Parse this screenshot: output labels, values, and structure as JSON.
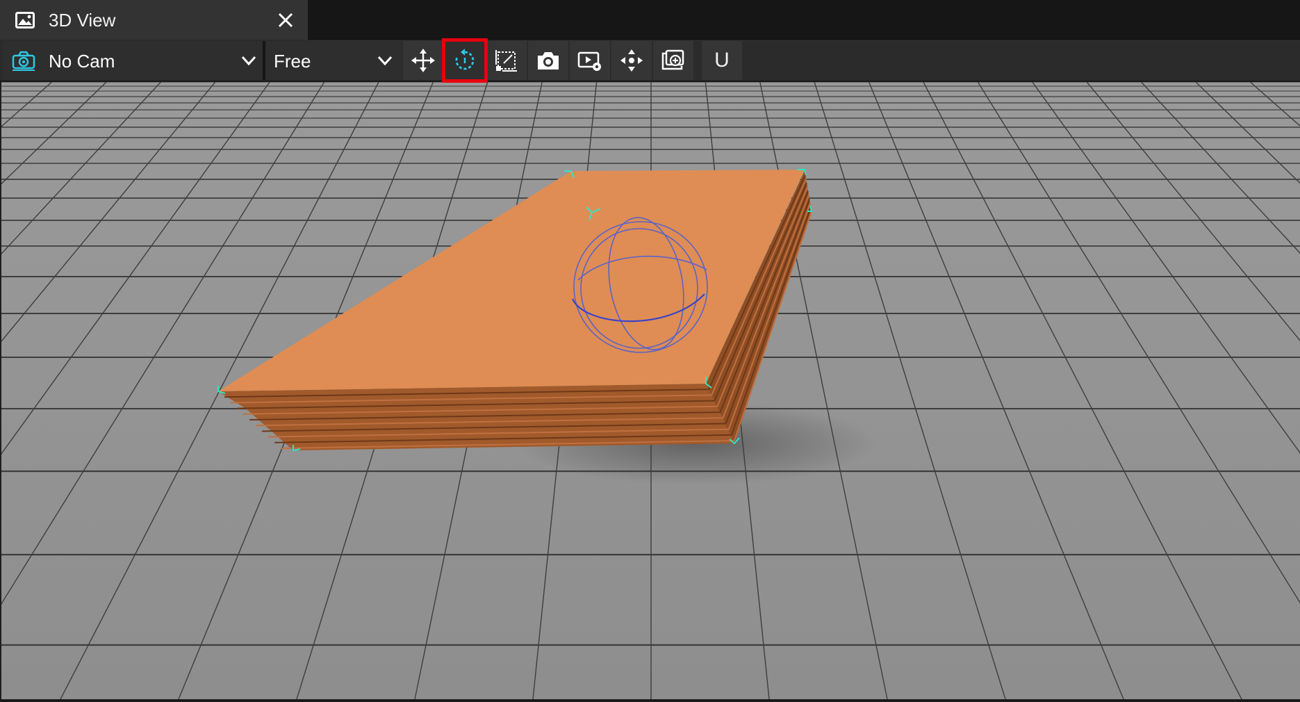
{
  "tab": {
    "title": "3D View",
    "icon": "image-icon",
    "close_icon": "close-icon"
  },
  "toolbar": {
    "camera_dropdown": {
      "value": "No Cam",
      "icon": "camera-view-icon"
    },
    "mode_dropdown": {
      "value": "Free"
    },
    "tools": [
      {
        "name": "move-icon",
        "label": ""
      },
      {
        "name": "rotate-icon",
        "label": "",
        "selected": true
      },
      {
        "name": "scale-icon",
        "label": ""
      },
      {
        "name": "camera-icon",
        "label": ""
      },
      {
        "name": "render-settings-icon",
        "label": ""
      },
      {
        "name": "center-view-icon",
        "label": ""
      },
      {
        "name": "add-camera-icon",
        "label": ""
      },
      {
        "name": "u-button",
        "label": "U"
      }
    ],
    "u_label": "U"
  },
  "viewport": {
    "description_colors": {
      "ground": "#8a8a8a",
      "grid_line": "#3a3a3a",
      "object_top": "#df8d54",
      "object_side": "#a0582a",
      "selection_marker": "#2ee6c8",
      "gizmo": "#5b63c8"
    }
  },
  "colors": {
    "tab_bg": "#333333",
    "toolbar_bg": "#2b2b2b",
    "accent_cyan": "#2ec9e6",
    "highlight_red": "#e8000f"
  }
}
